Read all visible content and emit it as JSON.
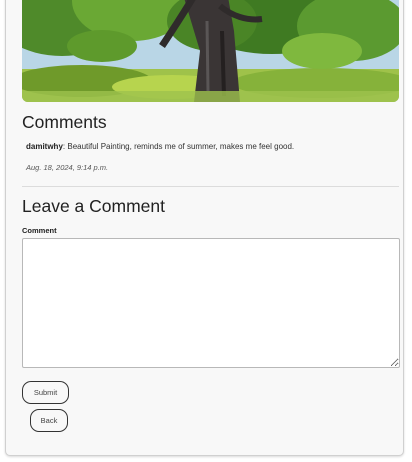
{
  "comments_section": {
    "title": "Comments",
    "items": [
      {
        "author": "damitwhy",
        "separator": ": ",
        "text": "Beautiful Painting, reminds me of summer, makes me feel good.",
        "date": "Aug. 18, 2024, 9:14 p.m."
      }
    ]
  },
  "comment_form": {
    "title": "Leave a Comment",
    "label": "Comment",
    "value": "",
    "submit_label": "Submit",
    "back_label": "Back"
  },
  "colors": {
    "card_background": "#f8f8f8",
    "button_border": "#333333",
    "text": "#222222"
  }
}
